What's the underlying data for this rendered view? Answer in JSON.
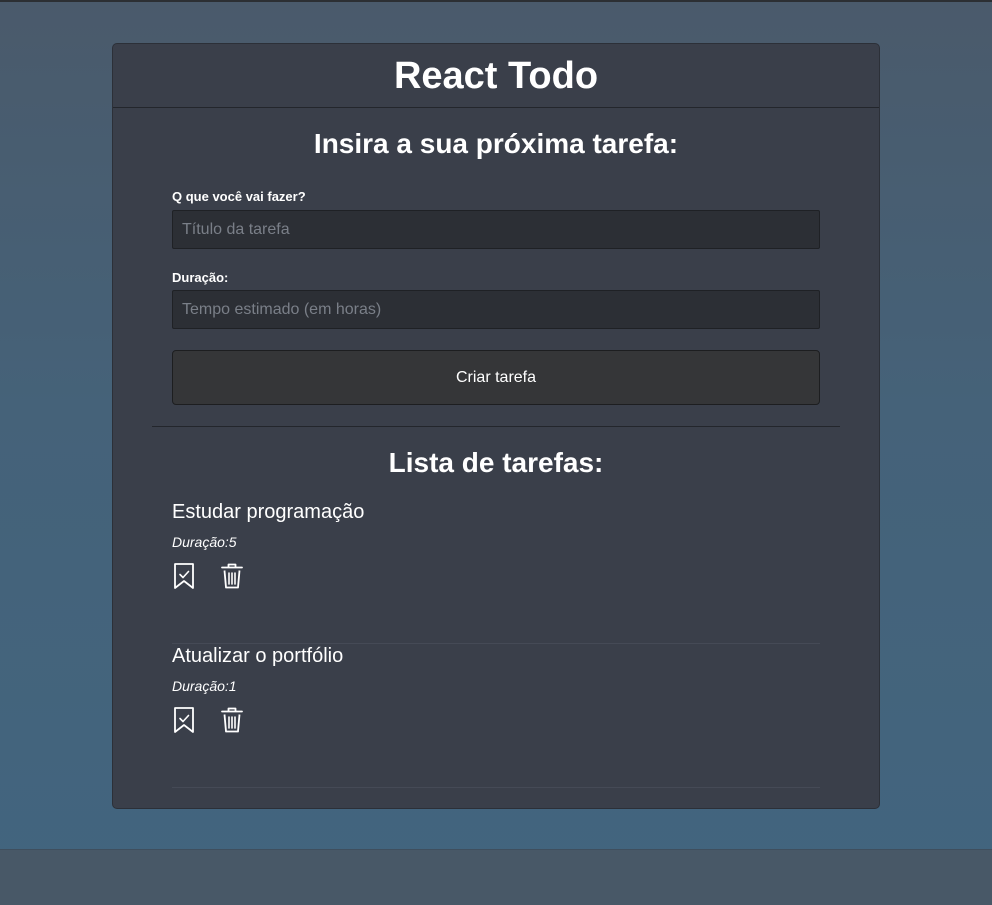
{
  "app": {
    "title": "React Todo"
  },
  "form": {
    "heading": "Insira a sua próxima tarefa:",
    "title_label": "Q que você vai fazer?",
    "title_placeholder": "Título da tarefa",
    "duration_label": "Duração:",
    "duration_placeholder": "Tempo estimado (em horas)",
    "submit_label": "Criar tarefa"
  },
  "list": {
    "heading": "Lista de tarefas:",
    "tasks": [
      {
        "title": "Estudar programação",
        "duration": "Duração:5"
      },
      {
        "title": "Atualizar o portfólio",
        "duration": "Duração:1"
      }
    ],
    "icons": {
      "complete": "bookmark-check-icon",
      "delete": "trash-icon"
    }
  },
  "colors": {
    "card_background": "#3a3f4a",
    "input_background": "#2c2f35",
    "button_background": "#353638",
    "text": "#ffffff"
  }
}
